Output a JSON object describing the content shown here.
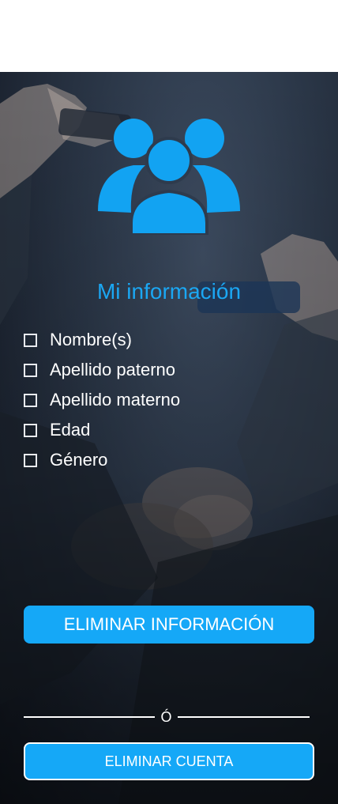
{
  "header": {
    "icon": "users-group-icon"
  },
  "title": "Mi información",
  "checklist": {
    "items": [
      {
        "label": "Nombre(s)",
        "checked": false
      },
      {
        "label": "Apellido paterno",
        "checked": false
      },
      {
        "label": "Apellido materno",
        "checked": false
      },
      {
        "label": "Edad",
        "checked": false
      },
      {
        "label": "Género",
        "checked": false
      }
    ]
  },
  "actions": {
    "delete_info_label": "ELIMINAR INFORMACIÓN",
    "separator": "Ó",
    "delete_account_label": "ELIMINAR CUENTA"
  },
  "colors": {
    "accent": "#15a8f7",
    "title": "#1ba7f3"
  }
}
